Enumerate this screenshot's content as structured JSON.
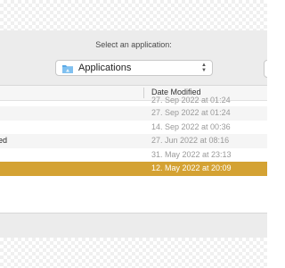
{
  "dialog": {
    "prompt": "Select an application:",
    "location_popup": {
      "label": "Applications",
      "icon": "folder-icon",
      "indicator": "updown-chevron-icon"
    }
  },
  "file_list": {
    "columns": [
      "Date Modified"
    ],
    "rows": [
      {
        "name": "",
        "date": "27. Sep 2022 at 01:24",
        "partial": true
      },
      {
        "name": "",
        "date": "27. Sep 2022 at 01:24"
      },
      {
        "name": "",
        "date": "14. Sep 2022 at 00:36"
      },
      {
        "name": "ed",
        "date": "27. Jun 2022 at 08:16"
      },
      {
        "name": "",
        "date": "31. May 2022 at 23:13"
      },
      {
        "name": "",
        "date": "12. May 2022 at 20:09",
        "selected": true
      }
    ]
  },
  "colors": {
    "selection": "#d4a233",
    "window_bg": "#ececec",
    "folder_blue": "#5aa9e6"
  }
}
